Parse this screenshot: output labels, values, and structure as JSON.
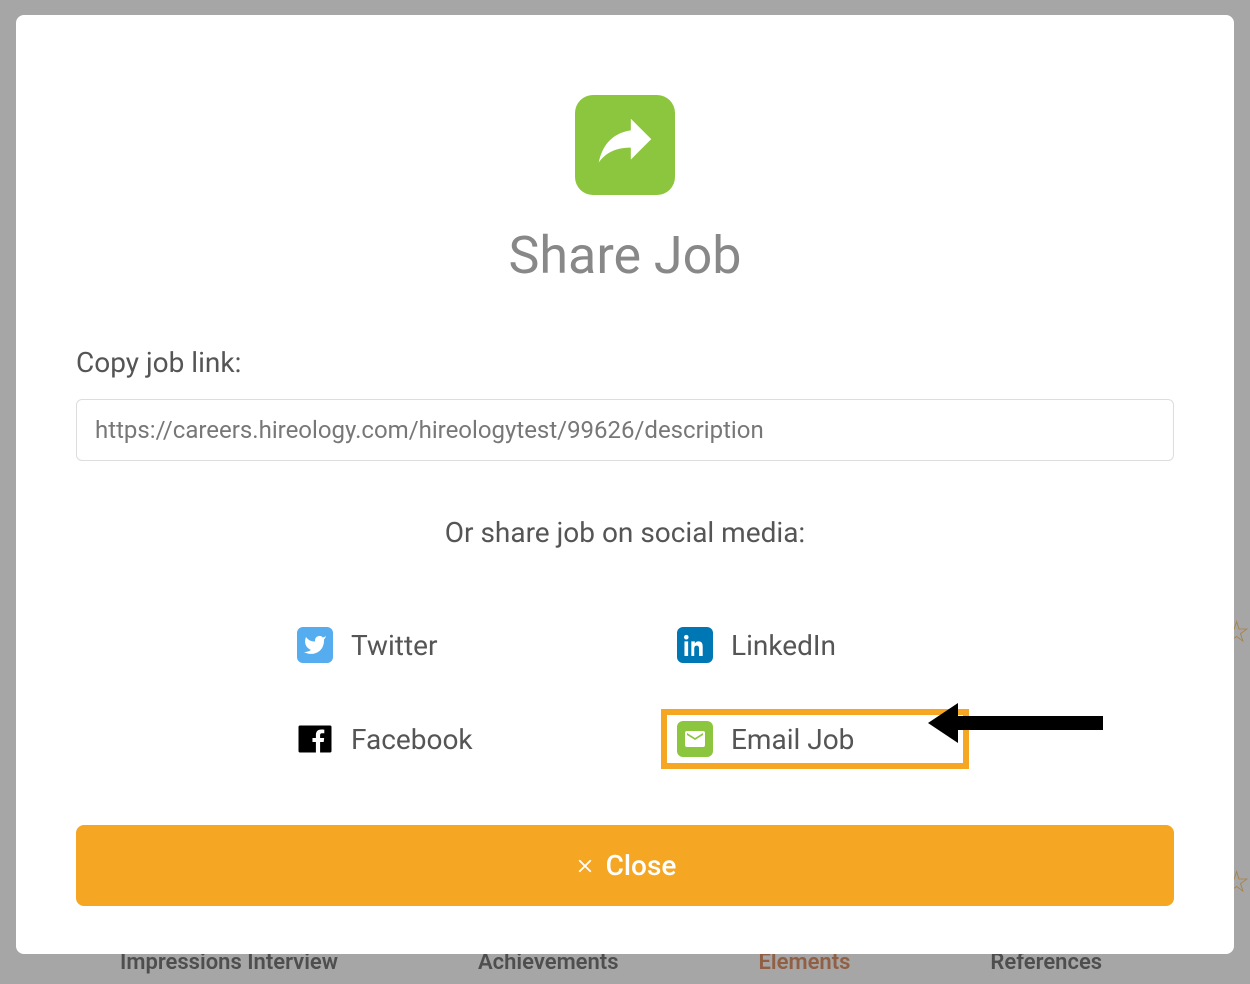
{
  "modal": {
    "title": "Share Job",
    "copy_link_label": "Copy job link:",
    "link_value": "https://careers.hireology.com/hireologytest/99626/description",
    "social_label": "Or share job on social media:",
    "social": {
      "twitter": "Twitter",
      "linkedin": "LinkedIn",
      "facebook": "Facebook",
      "email": "Email Job"
    },
    "close_label": "Close"
  },
  "background": {
    "tabs": {
      "impressions": "Impressions Interview",
      "achievements": "Achievements",
      "elements": "Elements",
      "references": "References"
    }
  }
}
